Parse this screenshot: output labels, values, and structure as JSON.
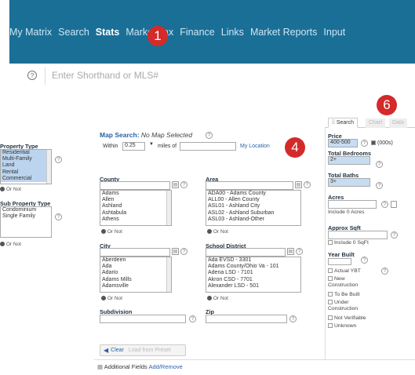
{
  "topnav": {
    "items": [
      "My Matrix",
      "Search",
      "Stats",
      "Market Tax",
      "Finance",
      "Links",
      "Market Reports",
      "Input"
    ],
    "active_index": 2
  },
  "markers": {
    "m1": "1",
    "m4": "4",
    "m6": "6"
  },
  "shorthand": {
    "placeholder": "Enter Shorthand or MLS#",
    "help_icon": "?"
  },
  "property": {
    "type_label": "Property Type",
    "types": [
      "Residential",
      "Multi-Family",
      "Land",
      "Rental",
      "Commercial"
    ],
    "or_not": "Or  Not",
    "sub_label": "Sub Property Type",
    "subtypes": [
      "Condominium",
      "Single Family"
    ],
    "or_not2": "Or  Not"
  },
  "map": {
    "title": "Map Search:",
    "status": "No Map Selected",
    "within": "Within",
    "within_value": "0.25",
    "miles_of": "miles of",
    "location_link": "My Location"
  },
  "county": {
    "label": "County",
    "items": [
      "Adams",
      "Allen",
      "Ashland",
      "Ashtabula",
      "Athens"
    ],
    "or_not": "Or  Not"
  },
  "area": {
    "label": "Area",
    "items": [
      "ADA00 - Adams County",
      "ALL00 - Allen County",
      "ASL01 - Ashland City",
      "ASL02 - Ashland Suburban",
      "ASL03 - Ashland-Other"
    ],
    "or_not": "Or  Not"
  },
  "city": {
    "label": "City",
    "items": [
      "Aberdeen",
      "Ada",
      "Adario",
      "Adams Mills",
      "Adamsville"
    ],
    "or_not": "Or  Not"
  },
  "school": {
    "label": "School District",
    "items": [
      "Ada EVSD - 3301",
      "Adams County/Ohio Va - 101",
      "Adena LSD - 7101",
      "Akron CSD - 7701",
      "Alexander LSD - 501"
    ],
    "or_not": "Or  Not"
  },
  "subdivision": {
    "label": "Subdivision"
  },
  "zip": {
    "label": "Zip"
  },
  "buttons": {
    "clear": "Clear",
    "load": "Load from Preset"
  },
  "additional": {
    "label": "Additional Fields",
    "link": "Add/Remove"
  },
  "tabs": {
    "search": "Search",
    "chart": "Chart",
    "data": "Data"
  },
  "right": {
    "price_label": "Price",
    "price_value": "400-500",
    "price_unit": "(000s)",
    "beds_label": "Total Bedrooms",
    "beds_value": "2+",
    "baths_label": "Total Baths",
    "baths_value": "3+",
    "acres_label": "Acres",
    "acres_include": "Include 0 Acres",
    "sqft_label": "Approx Sqft",
    "sqft_include": "Include 0 SqFt",
    "year_label": "Year Built",
    "year_options": [
      "Actual YBT",
      "New Construction",
      "To Be Built",
      "Under Construction",
      "Not Verifiable",
      "Unknown"
    ]
  }
}
